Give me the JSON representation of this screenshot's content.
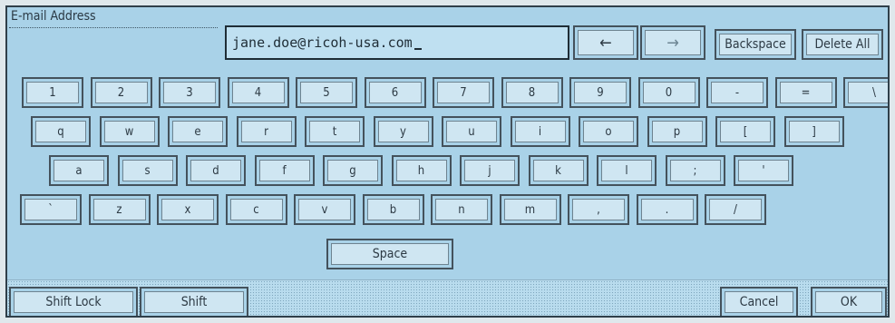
{
  "header": {
    "title": "E-mail Address",
    "entry_value": "jane.doe@ricoh-usa.com",
    "left_arrow": "←",
    "right_arrow": "→",
    "backspace": "Backspace",
    "delete_all": "Delete All"
  },
  "keyboard": {
    "row1": [
      "1",
      "2",
      "3",
      "4",
      "5",
      "6",
      "7",
      "8",
      "9",
      "0",
      "-",
      "=",
      "\\"
    ],
    "row2": [
      "q",
      "w",
      "e",
      "r",
      "t",
      "y",
      "u",
      "i",
      "o",
      "p",
      "[",
      "]"
    ],
    "row3": [
      "a",
      "s",
      "d",
      "f",
      "g",
      "h",
      "j",
      "k",
      "l",
      ";",
      "'"
    ],
    "row4": [
      "`",
      "z",
      "x",
      "c",
      "v",
      "b",
      "n",
      "m",
      ",",
      ".",
      "/"
    ],
    "space": "Space"
  },
  "footer": {
    "shift_lock": "Shift Lock",
    "shift": "Shift",
    "cancel": "Cancel",
    "ok": "OK"
  },
  "colors": {
    "panel": "#a9d2e8",
    "key": "#cfe6f2",
    "border": "#44525c"
  }
}
